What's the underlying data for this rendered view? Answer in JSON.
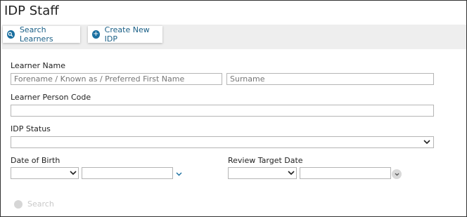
{
  "page": {
    "title": "IDP Staff"
  },
  "toolbar": {
    "search_learners": "Search Learners",
    "create_new_idp": "Create New IDP"
  },
  "form": {
    "learner_name_label": "Learner Name",
    "forename_placeholder": "Forename / Known as / Preferred First Name",
    "surname_placeholder": "Surname",
    "person_code_label": "Learner Person Code",
    "idp_status_label": "IDP Status",
    "dob_label": "Date of Birth",
    "review_target_label": "Review Target Date",
    "search_button": "Search"
  }
}
